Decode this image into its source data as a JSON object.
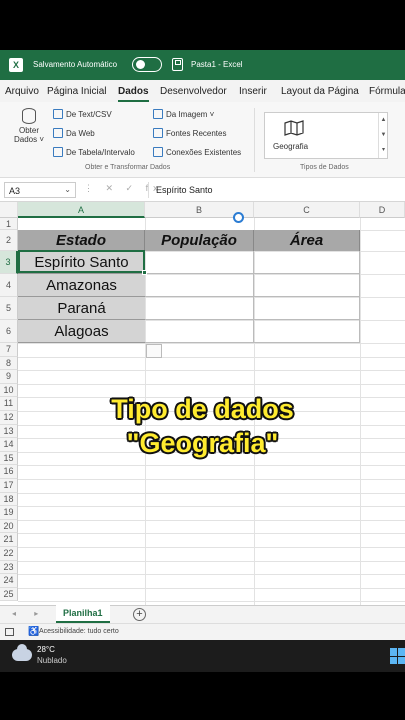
{
  "titlebar": {
    "autosave_label": "Salvamento Automático",
    "doc_title": "Pasta1  -  Excel"
  },
  "menu": {
    "tabs": [
      "Arquivo",
      "Página Inicial",
      "Dados",
      "Desenvolvedor",
      "Inserir",
      "Layout da Página",
      "Fórmulas"
    ],
    "active": "Dados"
  },
  "ribbon": {
    "obter_line1": "Obter",
    "obter_line2": "Dados ˅",
    "col1": [
      "De Text/CSV",
      "Da Web",
      "De Tabela/Intervalo"
    ],
    "col2": [
      "Da Imagem ˅",
      "Fontes Recentes",
      "Conexões Existentes"
    ],
    "group1_label": "Obter e Transformar Dados",
    "geo_label": "Geografia",
    "group2_label": "Tipos de Dados"
  },
  "formula": {
    "cell_ref": "A3",
    "fx_icons": "⋮ ✕ ✓ fx",
    "value": "Espírito Santo"
  },
  "columns": [
    "A",
    "B",
    "C",
    "D"
  ],
  "rows": [
    "1",
    "2",
    "3",
    "4",
    "5",
    "6",
    "7",
    "8",
    "9",
    "10",
    "11",
    "12",
    "13",
    "14",
    "15",
    "16",
    "17",
    "18",
    "19",
    "20",
    "21",
    "22",
    "23",
    "24",
    "25"
  ],
  "table": {
    "headers": [
      "Estado",
      "População",
      "Área"
    ],
    "states": [
      "Espírito Santo",
      "Amazonas",
      "Paraná",
      "Alagoas"
    ]
  },
  "overlay": {
    "line1": "Tipo de dados",
    "line2": "\"Geografia\""
  },
  "sheets": {
    "nav": "◂ ▸",
    "active_tab": "Planilha1",
    "add": "+"
  },
  "status": {
    "accessibility": "Acessibilidade: tudo certo"
  },
  "taskbar": {
    "temperature": "28°C",
    "condition": "Nublado"
  },
  "colors": {
    "excel_green": "#1f6e43",
    "header_fill": "#a8a8a8",
    "data_fill": "#d4d4d4",
    "overlay_text": "#ffeb2f"
  }
}
